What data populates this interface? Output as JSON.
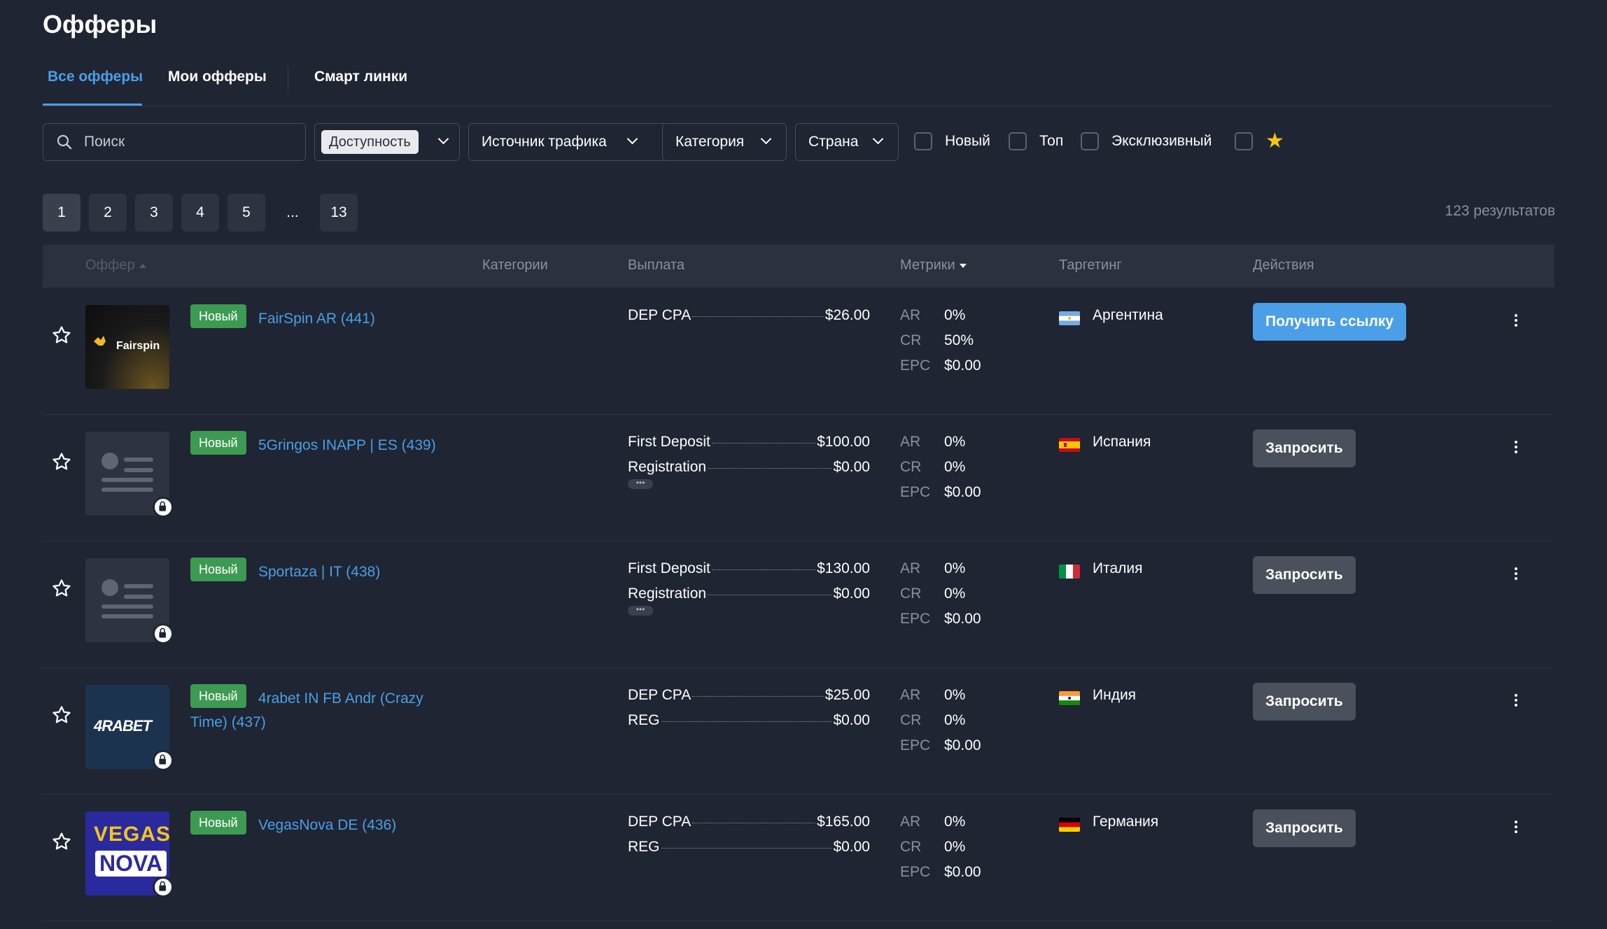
{
  "page": {
    "title": "Офферы"
  },
  "tabs": [
    {
      "label": "Все офферы",
      "active": true
    },
    {
      "label": "Мои офферы",
      "active": false
    },
    {
      "label": "Смарт линки",
      "active": false
    }
  ],
  "filters": {
    "search_placeholder": "Поиск",
    "availability": "Доступность",
    "traffic_source": "Источник трафика",
    "category": "Категория",
    "country": "Страна",
    "checkboxes": [
      "Новый",
      "Топ",
      "Эксклюзивный"
    ]
  },
  "pagination": {
    "pages": [
      "1",
      "2",
      "3",
      "4",
      "5"
    ],
    "ellipsis": "...",
    "last": "13",
    "current": "1",
    "results": "123  результатов"
  },
  "table": {
    "headers": {
      "offer": "Оффер",
      "categories": "Категории",
      "payout": "Выплата",
      "metrics": "Метрики",
      "targeting": "Таргетинг",
      "actions": "Действия"
    },
    "metric_labels": {
      "ar": "AR",
      "cr": "CR",
      "epc": "EPC"
    },
    "rows": [
      {
        "badge": "Новый",
        "title": "FairSpin AR (441)",
        "logo": "fairspin-logo",
        "logo_text": "Fairspin",
        "payouts": [
          {
            "name": "DEP CPA",
            "amount": "$26.00"
          }
        ],
        "more": false,
        "metrics": {
          "ar": "0%",
          "cr": "50%",
          "epc": "$0.00"
        },
        "country": "Аргентина",
        "action": "Получить ссылку",
        "locked": false
      },
      {
        "badge": "Новый",
        "title": "5Gringos INAPP | ES (439)",
        "logo": "placeholder-logo",
        "payouts": [
          {
            "name": "First Deposit",
            "amount": "$100.00"
          },
          {
            "name": "Registration",
            "amount": "$0.00"
          }
        ],
        "more": true,
        "metrics": {
          "ar": "0%",
          "cr": "0%",
          "epc": "$0.00"
        },
        "country": "Испания",
        "action": "Запросить",
        "locked": true
      },
      {
        "badge": "Новый",
        "title": "Sportaza | IT (438)",
        "logo": "placeholder-logo",
        "payouts": [
          {
            "name": "First Deposit",
            "amount": "$130.00"
          },
          {
            "name": "Registration",
            "amount": "$0.00"
          }
        ],
        "more": true,
        "metrics": {
          "ar": "0%",
          "cr": "0%",
          "epc": "$0.00"
        },
        "country": "Италия",
        "action": "Запросить",
        "locked": true
      },
      {
        "badge": "Новый",
        "title_line1": "4rabet IN FB Andr (Crazy",
        "title_line2": "Time) (437)",
        "logo": "4rabet-logo",
        "logo_text": "4RABET",
        "payouts": [
          {
            "name": "DEP CPA",
            "amount": "$25.00"
          },
          {
            "name": "REG",
            "amount": "$0.00"
          }
        ],
        "more": false,
        "metrics": {
          "ar": "0%",
          "cr": "0%",
          "epc": "$0.00"
        },
        "country": "Индия",
        "action": "Запросить",
        "locked": true
      },
      {
        "badge": "Новый",
        "title": "VegasNova DE (436)",
        "logo": "vegasnova-logo",
        "logo_text_1": "VEGAS",
        "logo_text_2": "NOVA",
        "payouts": [
          {
            "name": "DEP CPA",
            "amount": "$165.00"
          },
          {
            "name": "REG",
            "amount": "$0.00"
          }
        ],
        "more": false,
        "metrics": {
          "ar": "0%",
          "cr": "0%",
          "epc": "$0.00"
        },
        "country": "Германия",
        "action": "Запросить",
        "locked": true
      }
    ]
  },
  "colors": {
    "background": "#1f2532",
    "accent": "#4a9fe8",
    "badge_green": "#3d9a52",
    "star_yellow": "#f5c518"
  }
}
